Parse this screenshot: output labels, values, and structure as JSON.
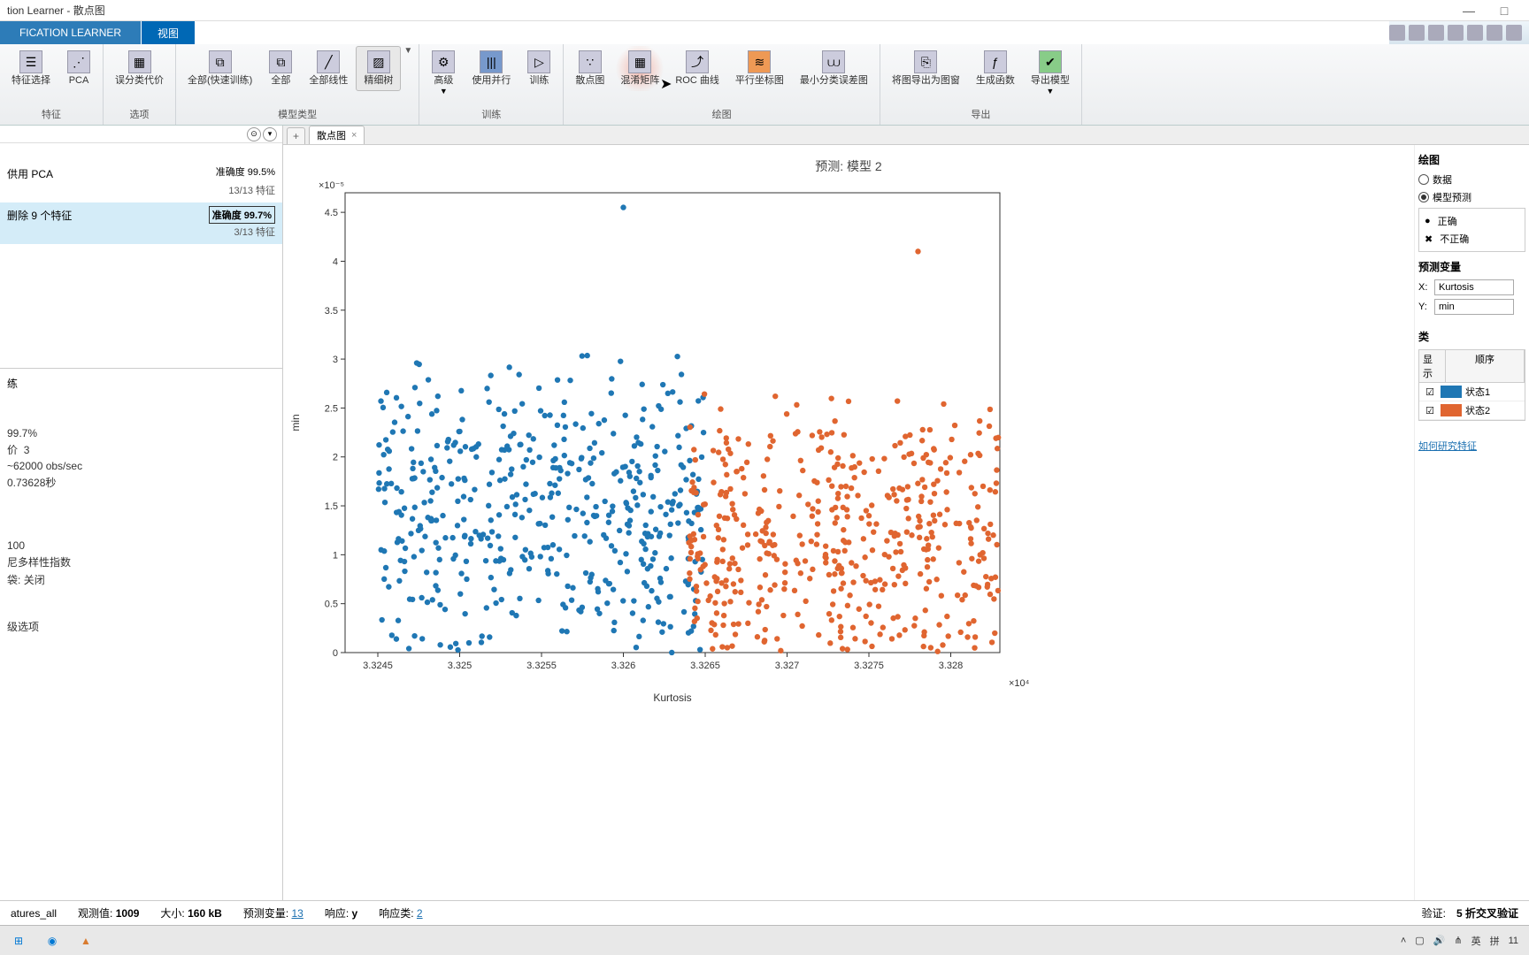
{
  "window": {
    "title": "tion Learner - 散点图"
  },
  "menubar": {
    "tab1": "FICATION LEARNER",
    "tab2": "视图"
  },
  "ribbon": {
    "groups": {
      "features": {
        "label": "特征",
        "feat_select": "特征选择",
        "pca": "PCA"
      },
      "options": {
        "label": "选项",
        "misclass": "误分类代价"
      },
      "model_type": {
        "label": "模型类型",
        "all_fast": "全部(快速训练)",
        "all": "全部",
        "all_linear": "全部线性",
        "fine_tree": "精细树"
      },
      "training": {
        "label": "训练",
        "advanced": "高级",
        "parallel": "使用并行",
        "train": "训练"
      },
      "plots": {
        "label": "绘图",
        "scatter": "散点图",
        "confusion": "混淆矩阵",
        "roc": "ROC 曲线",
        "parallel": "平行坐标图",
        "min_err": "最小分类误差图"
      },
      "export": {
        "label": "导出",
        "fig_to_figure": "将图导出为图窗",
        "gen_func": "生成函数",
        "export_model": "导出模型"
      }
    }
  },
  "tabs": {
    "scatter": "散点图"
  },
  "models": {
    "m1": {
      "name": "供用 PCA",
      "acc_label": "准确度",
      "acc_val": "99.5%",
      "sub": "13/13 特征"
    },
    "m2": {
      "name": "删除 9 个特征",
      "acc_label": "准确度",
      "acc_val": "99.7%",
      "sub": "3/13 特征"
    }
  },
  "details": {
    "h": "练",
    "acc": "99.7%",
    "cost_label": "价",
    "cost": "3",
    "speed": "~62000 obs/sec",
    "time": "0.73628秒",
    "splits": "100",
    "criterion": "尼多样性指数",
    "surrogate_label": "袋:",
    "surrogate": "关闭",
    "adv": "级选项"
  },
  "chart": {
    "title": "预测: 模型 2",
    "xlabel": "Kurtosis",
    "ylabel": "min",
    "y_exp": "×10⁻⁵",
    "x_exp": "×10⁴"
  },
  "chart_data": {
    "type": "scatter",
    "title": "预测: 模型 2",
    "xlabel": "Kurtosis",
    "ylabel": "min",
    "x_scale": 10000.0,
    "y_scale": 1e-05,
    "xlim": [
      3.3243,
      3.3283
    ],
    "ylim": [
      0,
      4.7
    ],
    "xticks": [
      3.3245,
      3.325,
      3.3255,
      3.326,
      3.3265,
      3.327,
      3.3275,
      3.328
    ],
    "yticks": [
      0,
      0.5,
      1,
      1.5,
      2,
      2.5,
      3,
      3.5,
      4,
      4.5
    ],
    "series": [
      {
        "name": "状态1",
        "color": "#1f77b4",
        "note": "approx 500 points, Kurtosis roughly 3.3245–3.3265, min roughly 0.3–3.5 (×10⁻⁵)"
      },
      {
        "name": "状态2",
        "color": "#e06530",
        "note": "approx 500 points, Kurtosis roughly 3.3263–3.3283, min roughly 0.2–2.8 with outlier ~4.1 (×10⁻⁵)"
      }
    ],
    "legend": {
      "correct": "正确",
      "incorrect": "不正确"
    }
  },
  "right_panel": {
    "plot_header": "绘图",
    "opt_data": "数据",
    "opt_model": "模型预测",
    "legend_correct": "正确",
    "legend_incorrect": "不正确",
    "pred_header": "预测变量",
    "x_label": "X:",
    "y_label": "Y:",
    "x_val": "Kurtosis",
    "y_val": "min",
    "class_header": "类",
    "col_show": "显示",
    "col_order": "顺序",
    "class1": "状态1",
    "class2": "状态2",
    "link": "如何研究特征"
  },
  "status": {
    "features": "atures_all",
    "obs_label": "观测值:",
    "obs_val": "1009",
    "size_label": "大小:",
    "size_val": "160 kB",
    "pred_label": "预测变量:",
    "pred_val": "13",
    "resp_label": "响应:",
    "resp_val": "y",
    "resp_class_label": "响应类:",
    "resp_class_val": "2",
    "validation_label": "验证:",
    "validation_val": "5 折交叉验证"
  },
  "tray": {
    "ime1": "英",
    "ime2": "拼",
    "time": "11"
  },
  "colors": {
    "class1": "#1f77b4",
    "class2": "#e06530"
  }
}
